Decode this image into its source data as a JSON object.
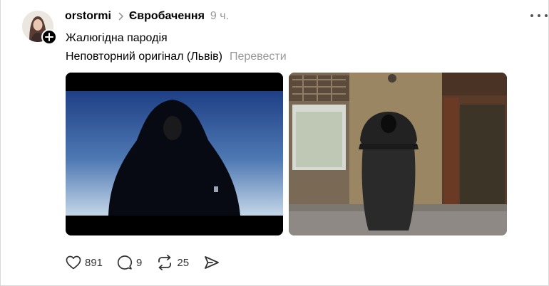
{
  "post": {
    "username": "orstormi",
    "community": "Євробачення",
    "time": "9 ч.",
    "text_line1": "Жалюгідна пародія",
    "text_line2": "Неповторний оригінал (Львів)",
    "translate_label": "Перевести"
  },
  "actions": {
    "likes": "891",
    "replies": "9",
    "reposts": "25"
  },
  "icons": {
    "avatar": "avatar",
    "follow": "plus-icon",
    "more": "more-icon",
    "like": "heart-icon",
    "reply": "comment-icon",
    "repost": "repost-icon",
    "share": "send-icon"
  }
}
